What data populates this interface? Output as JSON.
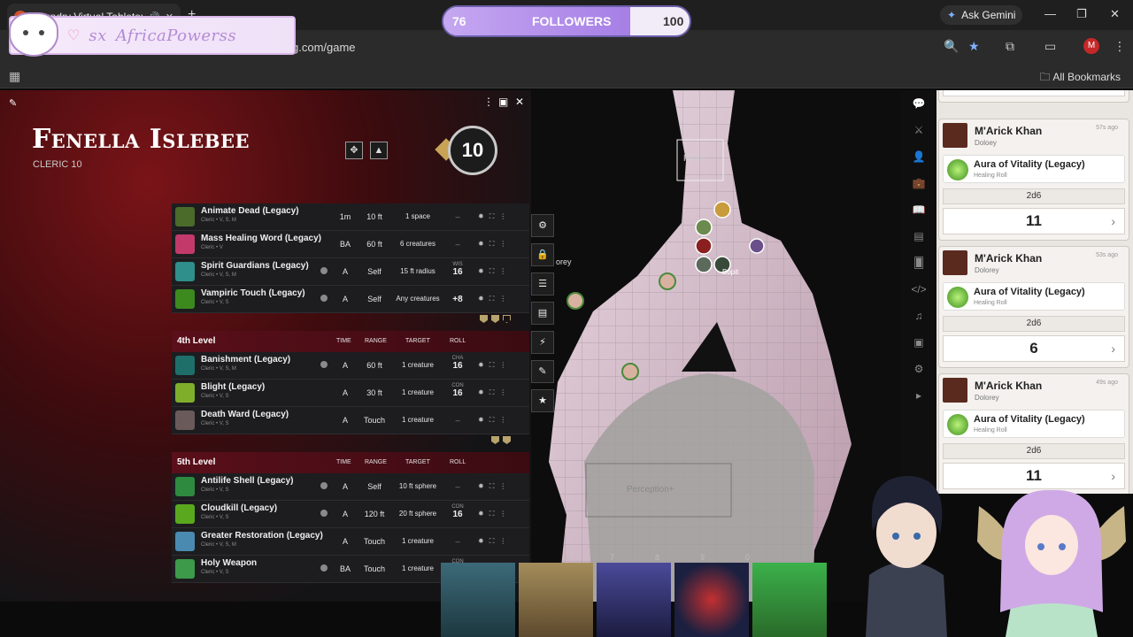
{
  "browser": {
    "tab_title": "Foundry Virtual Tabletop",
    "new_tab": "+",
    "url": "g.com/game",
    "gemini_label": "Ask Gemini",
    "avatar_letter": "M",
    "all_bookmarks": "All Bookmarks"
  },
  "overlays": {
    "handle": "AfricaPowerss",
    "handle_prefix": "sx",
    "followers_current": "76",
    "followers_label": "FOLLOWERS",
    "followers_goal": "100",
    "followers_fraction": 0.76
  },
  "character": {
    "name": "Fenella Islebee",
    "class_line": "CLERIC 10",
    "level": "10"
  },
  "spell_groups": [
    {
      "header": "",
      "rows": [
        {
          "name": "Animate Dead (Legacy)",
          "sub": "Cleric • V, S, M",
          "conc": false,
          "time": "1m",
          "range": "10 ft",
          "target": "1 space",
          "roll_label": "",
          "roll_value": "",
          "icon_color": "#4b6b2a"
        },
        {
          "name": "Mass Healing Word (Legacy)",
          "sub": "Cleric • V",
          "conc": false,
          "time": "BA",
          "range": "60 ft",
          "target": "6 creatures",
          "roll_label": "",
          "roll_value": "",
          "icon_color": "#c23a6a"
        },
        {
          "name": "Spirit Guardians (Legacy)",
          "sub": "Cleric • V, S, M",
          "conc": true,
          "time": "A",
          "range": "Self",
          "target": "15 ft radius",
          "roll_label": "WIS",
          "roll_value": "16",
          "icon_color": "#2f8f8a"
        },
        {
          "name": "Vampiric Touch (Legacy)",
          "sub": "Cleric • V, S",
          "conc": true,
          "time": "A",
          "range": "Self",
          "target": "Any creatures",
          "roll_label": "",
          "roll_value": "+8",
          "icon_color": "#3c8a1e"
        }
      ]
    },
    {
      "header": "4th Level",
      "rows": [
        {
          "name": "Banishment (Legacy)",
          "sub": "Cleric • V, S, M",
          "conc": true,
          "time": "A",
          "range": "60 ft",
          "target": "1 creature",
          "roll_label": "CHA",
          "roll_value": "16",
          "icon_color": "#1e6f6a"
        },
        {
          "name": "Blight (Legacy)",
          "sub": "Cleric • V, S",
          "conc": false,
          "time": "A",
          "range": "30 ft",
          "target": "1 creature",
          "roll_label": "CON",
          "roll_value": "16",
          "icon_color": "#7fae2a"
        },
        {
          "name": "Death Ward (Legacy)",
          "sub": "Cleric • V, S",
          "conc": false,
          "time": "A",
          "range": "Touch",
          "target": "1 creature",
          "roll_label": "",
          "roll_value": "",
          "icon_color": "#6a5a5a"
        }
      ]
    },
    {
      "header": "5th Level",
      "rows": [
        {
          "name": "Antilife Shell (Legacy)",
          "sub": "Cleric • V, S",
          "conc": true,
          "time": "A",
          "range": "Self",
          "target": "10 ft sphere",
          "roll_label": "",
          "roll_value": "",
          "icon_color": "#2e8a3e"
        },
        {
          "name": "Cloudkill (Legacy)",
          "sub": "Cleric • V, S",
          "conc": true,
          "time": "A",
          "range": "120 ft",
          "target": "20 ft sphere",
          "roll_label": "CON",
          "roll_value": "16",
          "icon_color": "#5aa81e"
        },
        {
          "name": "Greater Restoration (Legacy)",
          "sub": "Cleric • V, S, M",
          "conc": false,
          "time": "A",
          "range": "Touch",
          "target": "1 creature",
          "roll_label": "",
          "roll_value": "",
          "icon_color": "#4a8ab0"
        },
        {
          "name": "Holy Weapon",
          "sub": "Cleric • V, S",
          "conc": true,
          "time": "BA",
          "range": "Touch",
          "target": "1 creature",
          "roll_label": "CON",
          "roll_value": "16",
          "icon_color": "#3c9a4a"
        }
      ]
    }
  ],
  "columns": {
    "time": "TIME",
    "range": "RANGE",
    "target": "TARGET",
    "roll": "ROLL"
  },
  "map": {
    "prone_label": "Prone",
    "token_name": "Bopit",
    "side_label": "orey",
    "perception_label": "Perception+",
    "ruler_numbers": [
      "6",
      "7",
      "8",
      "9",
      "0"
    ]
  },
  "chat": {
    "partial_total": "7",
    "messages": [
      {
        "speaker": "M'Arick Khan",
        "alias": "Doloey",
        "ago": "57s ago",
        "item": "Aura of Vitality (Legacy)",
        "item_sub": "Healing Roll",
        "formula": "2d6",
        "total": "11"
      },
      {
        "speaker": "M'Arick Khan",
        "alias": "Dolorey",
        "ago": "53s ago",
        "item": "Aura of Vitality (Legacy)",
        "item_sub": "Healing Roll",
        "formula": "2d6",
        "total": "6"
      },
      {
        "speaker": "M'Arick Khan",
        "alias": "Dolorey",
        "ago": "49s ago",
        "item": "Aura of Vitality (Legacy)",
        "item_sub": "Healing Roll",
        "formula": "2d6",
        "total": "11"
      }
    ]
  },
  "colors": {
    "sheet_red": "#7a1418",
    "level_header": "#5a0f1a",
    "chat_bg": "#e9e5e1",
    "followers_fill": "#a67fe6"
  }
}
